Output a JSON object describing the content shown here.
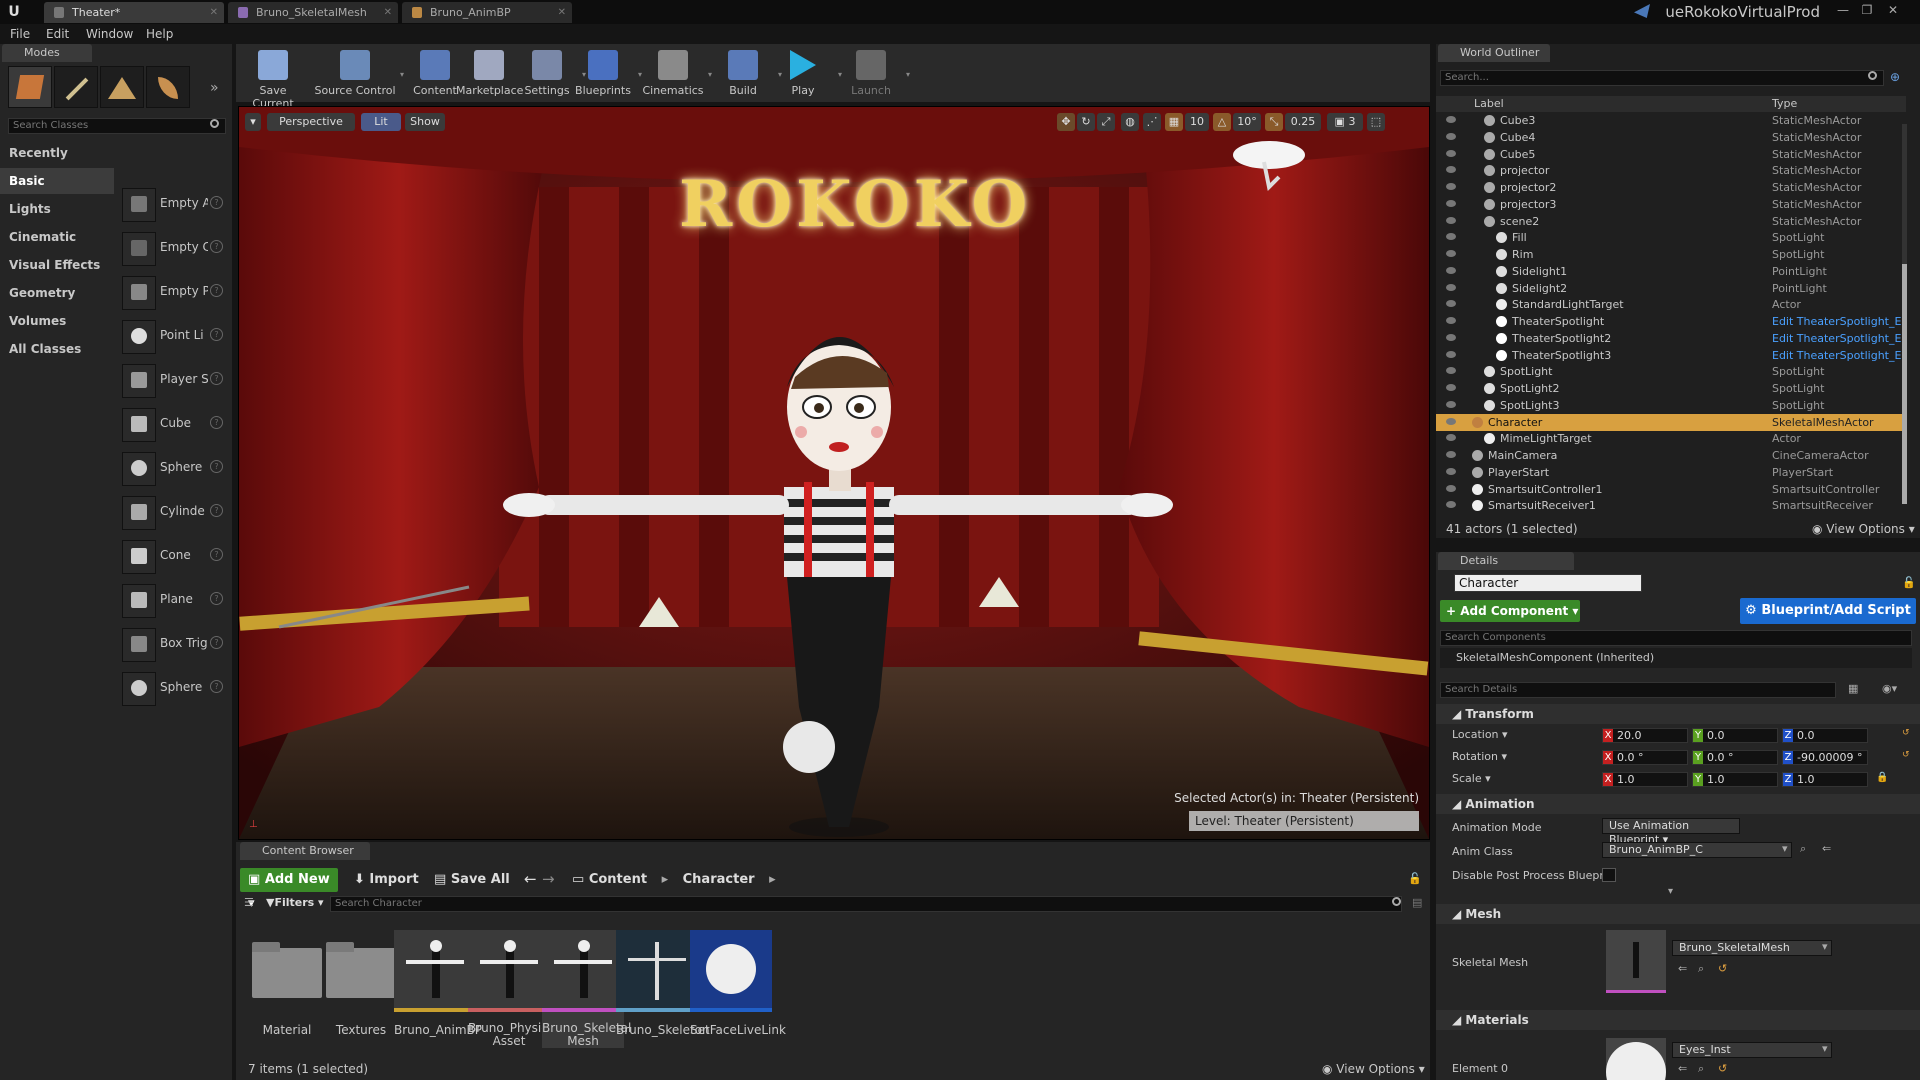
{
  "title_bar": {
    "tabs": [
      "Theater*",
      "Bruno_SkeletalMesh",
      "Bruno_AnimBP"
    ],
    "project_name": "ueRokokoVirtualProd"
  },
  "menu": [
    "File",
    "Edit",
    "Window",
    "Help"
  ],
  "modes_panel": {
    "tab_label": "Modes",
    "search_placeholder": "Search Classes",
    "categories": [
      "Recently Placed",
      "Basic",
      "Lights",
      "Cinematic",
      "Visual Effects",
      "Geometry",
      "Volumes",
      "All Classes"
    ],
    "active_category": "Basic",
    "items": [
      "Empty A",
      "Empty C",
      "Empty P",
      "Point Li",
      "Player S",
      "Cube",
      "Sphere",
      "Cylinde",
      "Cone",
      "Plane",
      "Box Trig",
      "Sphere"
    ]
  },
  "toolbar": {
    "buttons": [
      "Save Current",
      "Source Control",
      "Content",
      "Marketplace",
      "Settings",
      "Blueprints",
      "Cinematics",
      "Build",
      "Play",
      "Launch"
    ]
  },
  "viewport": {
    "perspective_label": "Perspective",
    "lit_label": "Lit",
    "show_label": "Show",
    "grid_snap": "10",
    "rot_snap": "10°",
    "scale_snap": "0.25",
    "camera_speed": "3",
    "sign_text": "ROKOKO",
    "selected_info": "Selected Actor(s) in:  Theater (Persistent)",
    "level_info": "Level:  Theater (Persistent)"
  },
  "world_outliner": {
    "tab_label": "World Outliner",
    "search_placeholder": "Search...",
    "col_label": "Label",
    "col_type": "Type",
    "rows": [
      {
        "label": "Cube3",
        "type": "StaticMeshActor",
        "indent": 2
      },
      {
        "label": "Cube4",
        "type": "StaticMeshActor",
        "indent": 2
      },
      {
        "label": "Cube5",
        "type": "StaticMeshActor",
        "indent": 2
      },
      {
        "label": "projector",
        "type": "StaticMeshActor",
        "indent": 2
      },
      {
        "label": "projector2",
        "type": "StaticMeshActor",
        "indent": 2
      },
      {
        "label": "projector3",
        "type": "StaticMeshActor",
        "indent": 2
      },
      {
        "label": "scene2",
        "type": "StaticMeshActor",
        "indent": 2
      },
      {
        "label": "Fill",
        "type": "SpotLight",
        "indent": 3
      },
      {
        "label": "Rim",
        "type": "SpotLight",
        "indent": 3
      },
      {
        "label": "Sidelight1",
        "type": "PointLight",
        "indent": 3
      },
      {
        "label": "Sidelight2",
        "type": "PointLight",
        "indent": 3
      },
      {
        "label": "StandardLightTarget",
        "type": "Actor",
        "indent": 3
      },
      {
        "label": "TheaterSpotlight",
        "type": "Edit TheaterSpotlight_E",
        "indent": 3
      },
      {
        "label": "TheaterSpotlight2",
        "type": "Edit TheaterSpotlight_E",
        "indent": 3
      },
      {
        "label": "TheaterSpotlight3",
        "type": "Edit TheaterSpotlight_E",
        "indent": 3
      },
      {
        "label": "SpotLight",
        "type": "SpotLight",
        "indent": 2
      },
      {
        "label": "SpotLight2",
        "type": "SpotLight",
        "indent": 2
      },
      {
        "label": "SpotLight3",
        "type": "SpotLight",
        "indent": 2
      },
      {
        "label": "Character",
        "type": "SkeletalMeshActor",
        "indent": 1
      },
      {
        "label": "MimeLightTarget",
        "type": "Actor",
        "indent": 2
      },
      {
        "label": "MainCamera",
        "type": "CineCameraActor",
        "indent": 1
      },
      {
        "label": "PlayerStart",
        "type": "PlayerStart",
        "indent": 1
      },
      {
        "label": "SmartsuitController1",
        "type": "SmartsuitController",
        "indent": 1
      },
      {
        "label": "SmartsuitReceiver1",
        "type": "SmartsuitReceiver",
        "indent": 1
      }
    ],
    "selected_row": 18,
    "footer_count": "41 actors (1 selected)",
    "view_options": "View Options"
  },
  "details": {
    "tab_label": "Details",
    "name_value": "Character",
    "add_component": "+ Add Component",
    "blueprint_btn": "Blueprint/Add Script",
    "search_components": "Search Components",
    "component_item": "SkeletalMeshComponent (Inherited)",
    "search_details": "Search Details",
    "transform": {
      "header": "Transform",
      "location_label": "Location",
      "rotation_label": "Rotation",
      "scale_label": "Scale",
      "location": [
        "20.0",
        "0.0",
        "0.0"
      ],
      "rotation": [
        "0.0 °",
        "0.0 °",
        "-90.00009 °"
      ],
      "scale": [
        "1.0",
        "1.0",
        "1.0"
      ]
    },
    "animation": {
      "header": "Animation",
      "mode_label": "Animation Mode",
      "mode_value": "Use Animation Blueprint",
      "class_label": "Anim Class",
      "class_value": "Bruno_AnimBP_C",
      "disable_label": "Disable Post Process Blueprin"
    },
    "mesh": {
      "header": "Mesh",
      "label": "Skeletal Mesh",
      "value": "Bruno_SkeletalMesh"
    },
    "materials": {
      "header": "Materials",
      "element_label": "Element 0",
      "value": "Eyes_Inst"
    }
  },
  "content_browser": {
    "tab_label": "Content Browser",
    "add_new": "Add New",
    "import": "Import",
    "save_all": "Save All",
    "path": [
      "Content",
      "Character"
    ],
    "filters": "Filters",
    "search_placeholder": "Search Character",
    "assets": [
      {
        "name": "Material",
        "kind": "folder"
      },
      {
        "name": "Textures",
        "kind": "folder"
      },
      {
        "name": "Bruno_AnimBP",
        "kind": "animbp"
      },
      {
        "name": "Bruno_Physics Asset",
        "kind": "physics"
      },
      {
        "name": "Bruno_Skeletal Mesh",
        "kind": "mesh"
      },
      {
        "name": "Bruno_Skeleton",
        "kind": "skeleton"
      },
      {
        "name": "SetFaceLiveLink",
        "kind": "livelink"
      }
    ],
    "footer_count": "7 items (1 selected)",
    "view_options": "View Options"
  },
  "colors": {
    "selection": "#d8a040",
    "accent_blue": "#1a6ad0",
    "accent_green": "#3a8a28",
    "curtain_red": "#8a1414"
  }
}
